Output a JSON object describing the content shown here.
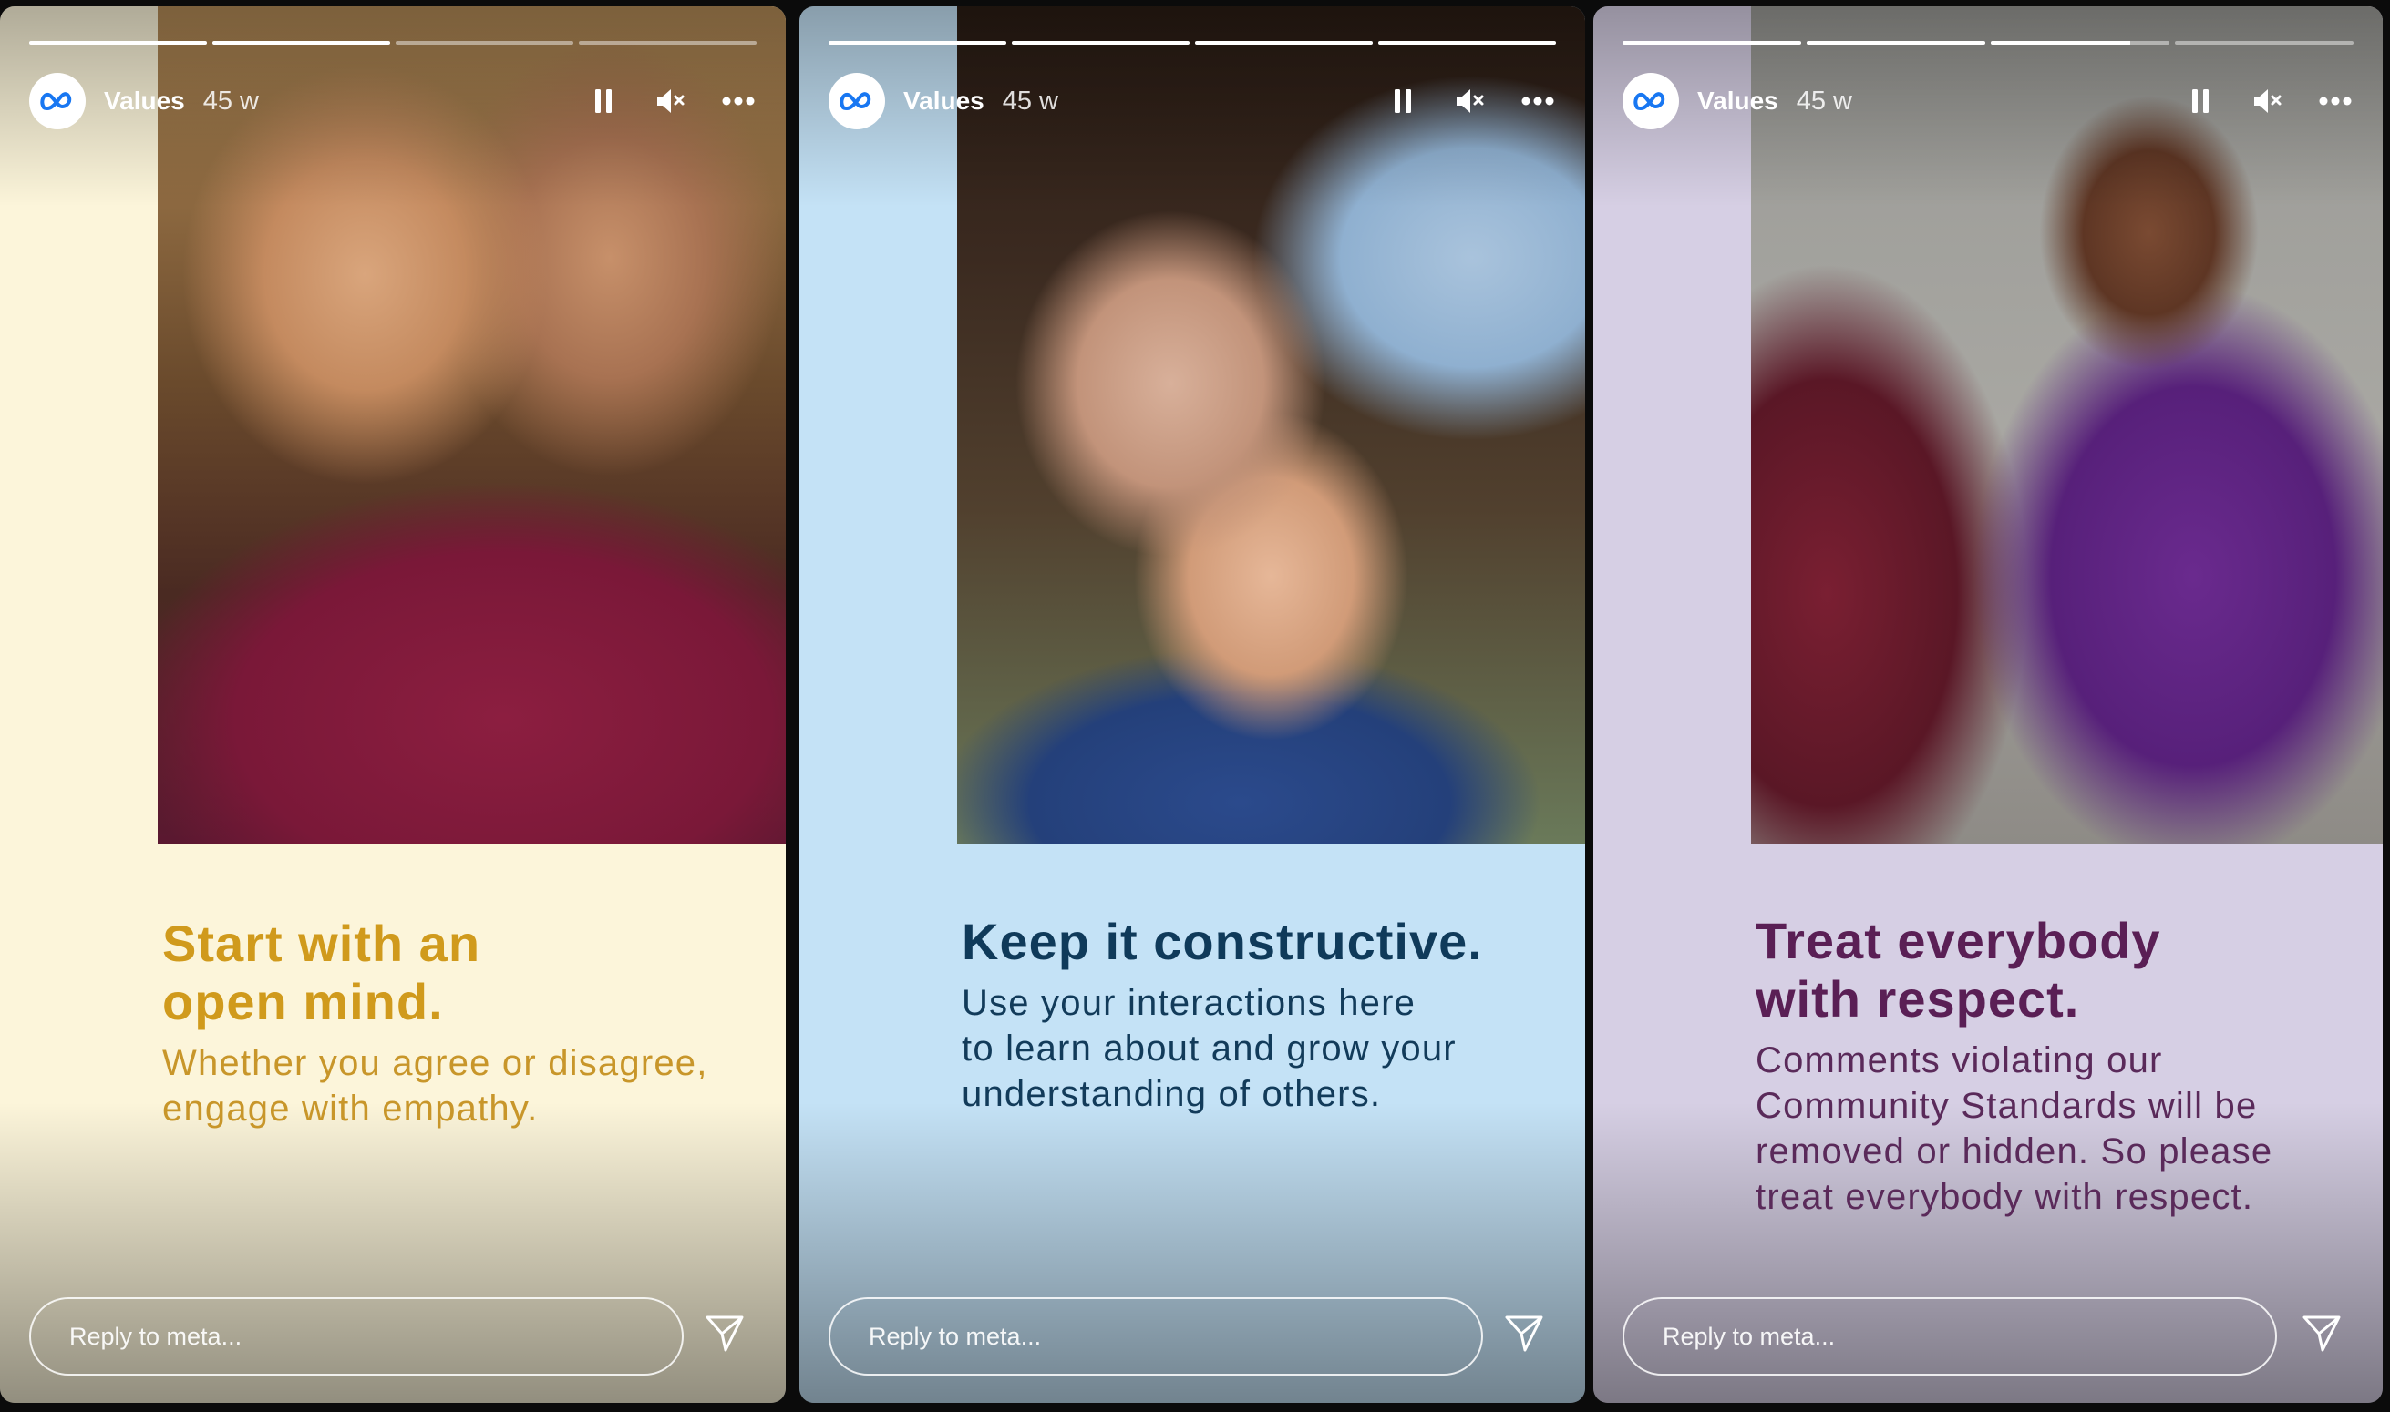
{
  "stories": [
    {
      "account": "Values",
      "age": "45 w",
      "headline_lines": [
        "Start with an",
        "open mind."
      ],
      "body_lines": [
        "Whether you agree or disagree,",
        "engage with empathy."
      ],
      "reply_placeholder": "Reply to meta...",
      "progress": [
        1,
        1,
        0,
        0
      ],
      "colors": {
        "background": "#fcf5da",
        "headline": "#d09a1c"
      }
    },
    {
      "account": "Values",
      "age": "45 w",
      "headline_lines": [
        "Keep it constructive."
      ],
      "body_lines": [
        "Use your interactions here",
        "to learn about and grow your",
        "understanding of others."
      ],
      "reply_placeholder": "Reply to meta...",
      "progress": [
        1,
        1,
        1,
        1
      ],
      "colors": {
        "background": "#c4e2f6",
        "headline": "#0f3a5a"
      }
    },
    {
      "account": "Values",
      "age": "45 w",
      "headline_lines": [
        "Treat everybody",
        "with respect."
      ],
      "body_lines": [
        "Comments violating our",
        "Community Standards will be",
        "removed or hidden. So please",
        "treat everybody with respect."
      ],
      "reply_placeholder": "Reply to meta...",
      "progress": [
        1,
        1,
        0.78,
        0
      ],
      "colors": {
        "background": "#d6cfe4",
        "headline": "#5a1f55"
      }
    }
  ],
  "icons": {
    "avatar": "meta-logo-icon",
    "pause": "pause-icon",
    "mute": "mute-icon",
    "more": "more-icon",
    "send": "send-icon"
  },
  "accent": "#1877f2"
}
